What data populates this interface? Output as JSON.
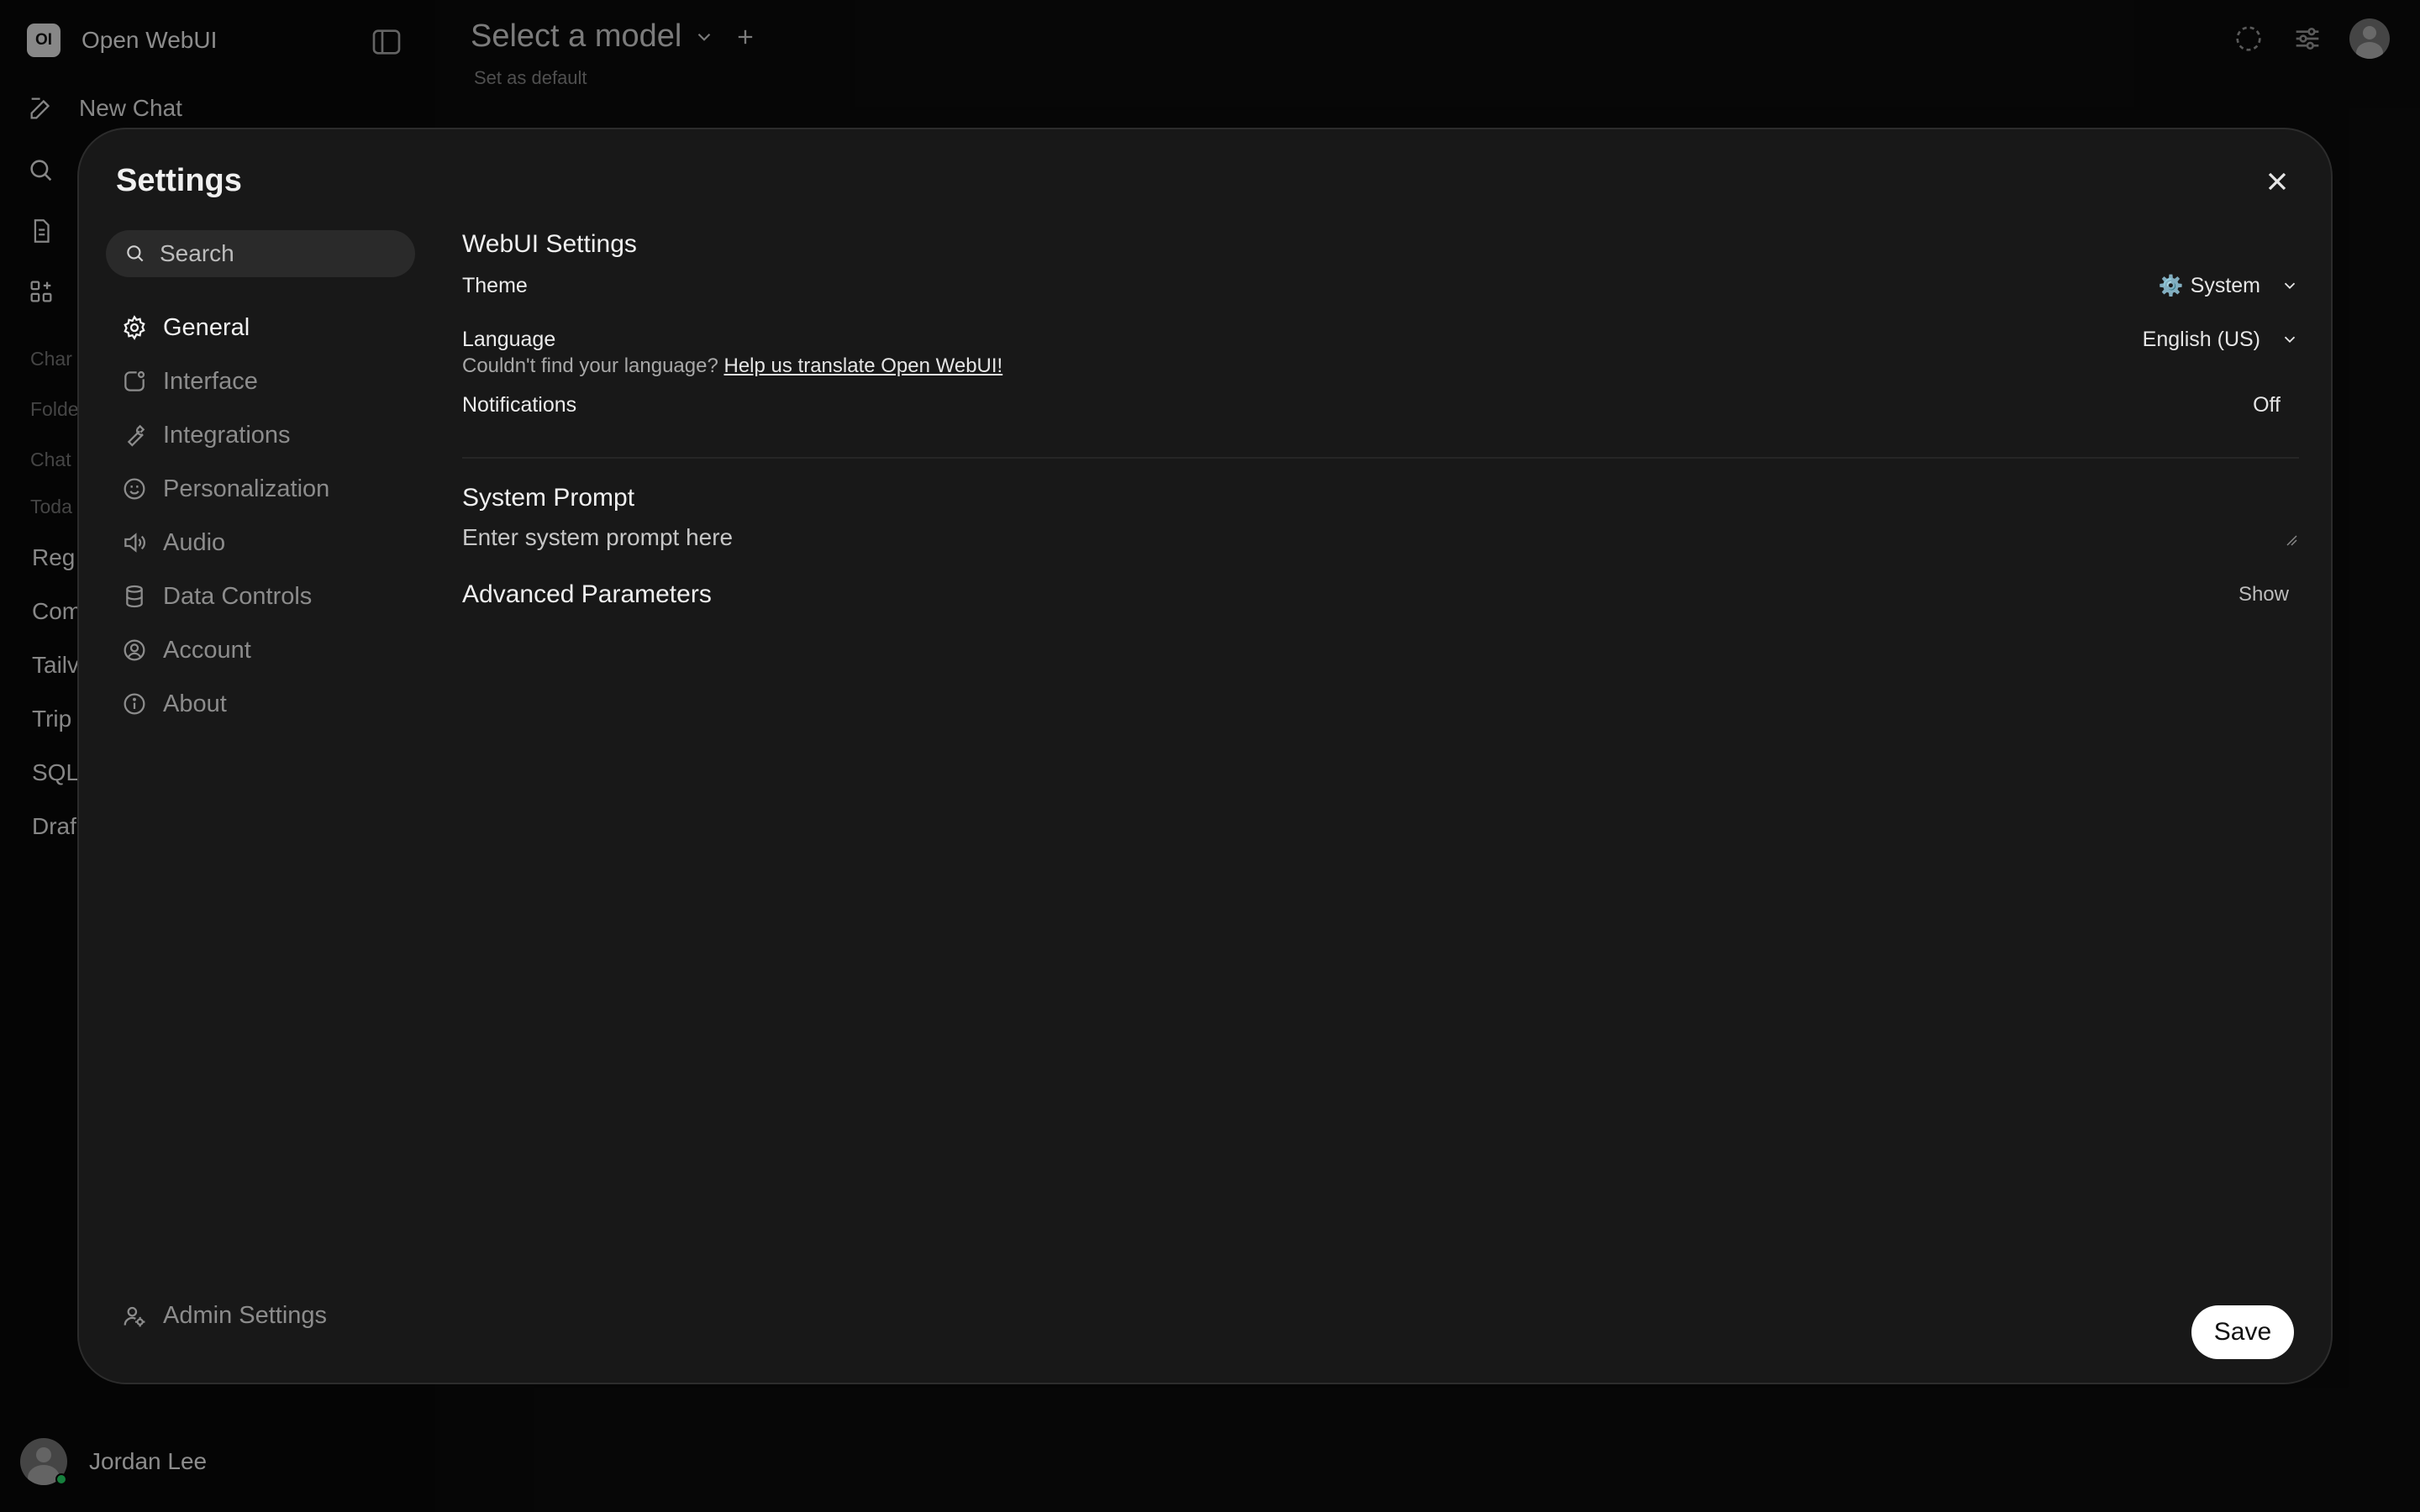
{
  "app": {
    "logo_text": "OI",
    "name": "Open WebUI"
  },
  "sidebar": {
    "new_chat": "New Chat",
    "sections": [
      "Char",
      "Folde",
      "Chat",
      "Toda"
    ],
    "chats": [
      "Reg",
      "Com",
      "Tailv",
      "Trip",
      "SQL",
      "Draf"
    ]
  },
  "user": {
    "name": "Jordan Lee",
    "status_color": "#22c55e"
  },
  "header": {
    "model_title": "Select a model",
    "set_default": "Set as default"
  },
  "settings": {
    "title": "Settings",
    "search_placeholder": "Search",
    "nav": [
      {
        "label": "General",
        "icon": "gear-icon",
        "active": true
      },
      {
        "label": "Interface",
        "icon": "interface-icon"
      },
      {
        "label": "Integrations",
        "icon": "wrench-icon"
      },
      {
        "label": "Personalization",
        "icon": "smile-icon"
      },
      {
        "label": "Audio",
        "icon": "speaker-icon"
      },
      {
        "label": "Data Controls",
        "icon": "database-icon"
      },
      {
        "label": "Account",
        "icon": "account-icon"
      },
      {
        "label": "About",
        "icon": "info-icon"
      }
    ],
    "admin_label": "Admin Settings",
    "webui_title": "WebUI Settings",
    "theme": {
      "label": "Theme",
      "icon": "⚙️",
      "value": "System"
    },
    "language": {
      "label": "Language",
      "value": "English (US)"
    },
    "language_help": {
      "text": "Couldn't find your language?",
      "link": "Help us translate Open WebUI!"
    },
    "notifications": {
      "label": "Notifications",
      "value": "Off"
    },
    "system_prompt": {
      "title": "System Prompt",
      "placeholder": "Enter system prompt here"
    },
    "advanced": {
      "title": "Advanced Parameters",
      "toggle": "Show"
    },
    "save_label": "Save"
  },
  "colors": {
    "modal_bg": "#181818",
    "page_bg": "#0a0a0a",
    "save_bg": "#ffffff"
  }
}
